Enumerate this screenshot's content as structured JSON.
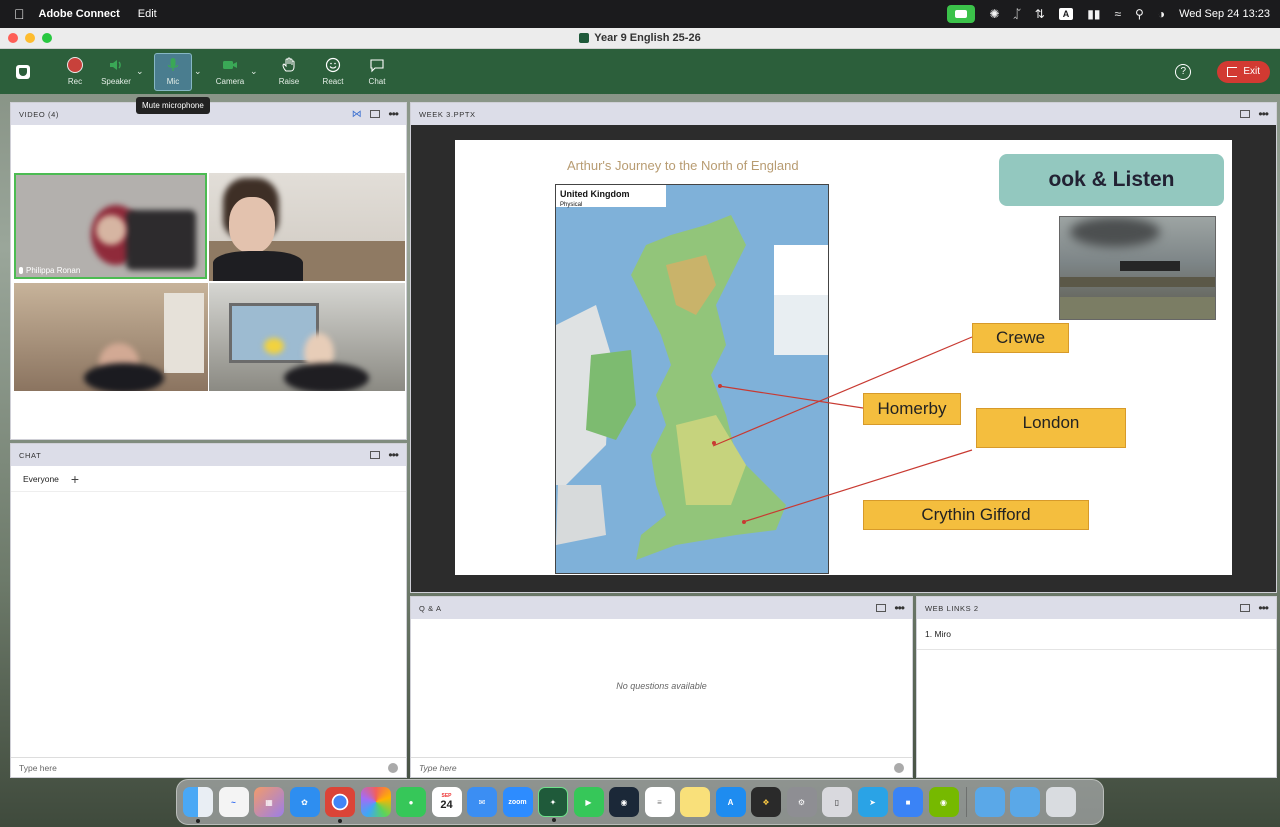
{
  "menubar": {
    "app_name": "Adobe Connect",
    "menu_items": [
      "Edit"
    ],
    "datetime": "Wed Sep 24  13:23",
    "input_source": "A"
  },
  "window": {
    "title": "Year 9 English 25-26"
  },
  "toolbar": {
    "buttons": {
      "rec": "Rec",
      "speaker": "Speaker",
      "mic": "Mic",
      "camera": "Camera",
      "raise": "Raise",
      "react": "React",
      "chat": "Chat"
    },
    "exit_label": "Exit",
    "mic_tooltip": "Mute microphone",
    "colors": {
      "bar": "#2c5f3b",
      "exit": "#d23a32",
      "mic_active": "#4a7d8f"
    }
  },
  "video_pod": {
    "title": "VIDEO (4)",
    "participants": [
      {
        "name": "Philippa Ronan",
        "speaking": true
      }
    ]
  },
  "chat_pod": {
    "title": "CHAT",
    "tab": "Everyone",
    "add_tab": "+",
    "input_placeholder": "Type here"
  },
  "share_pod": {
    "title": "WEEK 3.PPTX",
    "slide": {
      "title": "Arthur's Journey to the North of England",
      "look_box": "ook & Listen",
      "map_heading": "United Kingdom",
      "map_subheading": "Physical",
      "places": [
        "Crewe",
        "Homerby",
        "London",
        "Crythin Gifford"
      ]
    }
  },
  "qa_pod": {
    "title": "Q & A",
    "empty_text": "No questions available",
    "input_placeholder": "Type here"
  },
  "weblinks_pod": {
    "title": "WEB LINKS 2",
    "links": [
      "1. Miro"
    ]
  },
  "dock": {
    "calendar_month": "SEP",
    "calendar_day": "24",
    "zoom_label": "zoom"
  }
}
